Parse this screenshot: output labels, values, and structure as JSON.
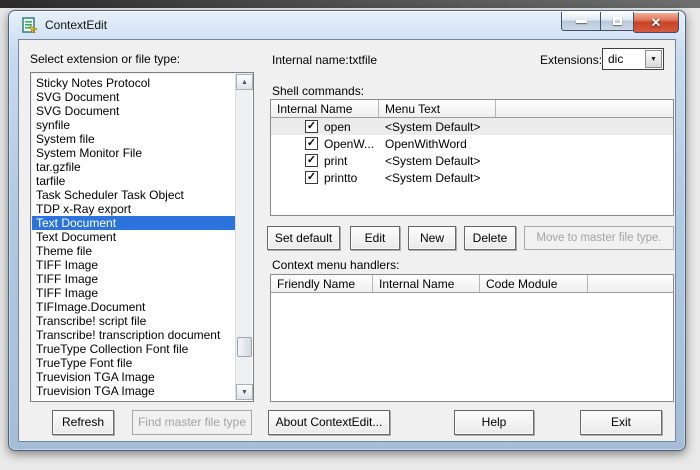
{
  "window": {
    "title": "ContextEdit"
  },
  "colors": {
    "selection": "#2b74dd",
    "close_button": "#c74228",
    "titlebar": "#b2c9e2"
  },
  "left_panel": {
    "label": "Select extension or file type:",
    "selected_index": 10,
    "items": [
      "Sticky Notes Protocol",
      "SVG Document",
      "SVG Document",
      "synfile",
      "System file",
      "System Monitor File",
      "tar.gzfile",
      "tarfile",
      "Task Scheduler Task Object",
      "TDP x-Ray export",
      "Text Document",
      "Text Document",
      "Theme file",
      "TIFF Image",
      "TIFF Image",
      "TIFF Image",
      "TIFImage.Document",
      "Transcribe! script file",
      "Transcribe! transcription document",
      "TrueType Collection Font file",
      "TrueType Font file",
      "Truevision TGA Image",
      "Truevision TGA Image"
    ]
  },
  "header_fields": {
    "internal_name_label": "Internal name:",
    "internal_name_value": "txtfile",
    "extensions_label": "Extensions:",
    "extensions_value": "dic"
  },
  "shell_commands": {
    "label": "Shell commands:",
    "columns": [
      "Internal Name",
      "Menu Text"
    ],
    "rows": [
      {
        "checked": true,
        "internal_name": "open",
        "menu_text": "<System Default>",
        "selected": true
      },
      {
        "checked": true,
        "internal_name": "OpenW...",
        "menu_text": "OpenWithWord",
        "selected": false
      },
      {
        "checked": true,
        "internal_name": "print",
        "menu_text": "<System Default>",
        "selected": false
      },
      {
        "checked": true,
        "internal_name": "printto",
        "menu_text": "<System Default>",
        "selected": false
      }
    ],
    "buttons": [
      {
        "label": "Set default",
        "enabled": true
      },
      {
        "label": "Edit",
        "enabled": true
      },
      {
        "label": "New",
        "enabled": true
      },
      {
        "label": "Delete",
        "enabled": true
      },
      {
        "label": "Move to master file type.",
        "enabled": false
      }
    ]
  },
  "context_menu_handlers": {
    "label": "Context menu handlers:",
    "columns": [
      "Friendly Name",
      "Internal Name",
      "Code Module"
    ],
    "rows": []
  },
  "bottom_buttons": [
    {
      "label": "Refresh",
      "enabled": true
    },
    {
      "label": "Find master file type",
      "enabled": false
    },
    {
      "label": "About ContextEdit...",
      "enabled": true
    },
    {
      "label": "Help",
      "enabled": true
    },
    {
      "label": "Exit",
      "enabled": true
    }
  ]
}
